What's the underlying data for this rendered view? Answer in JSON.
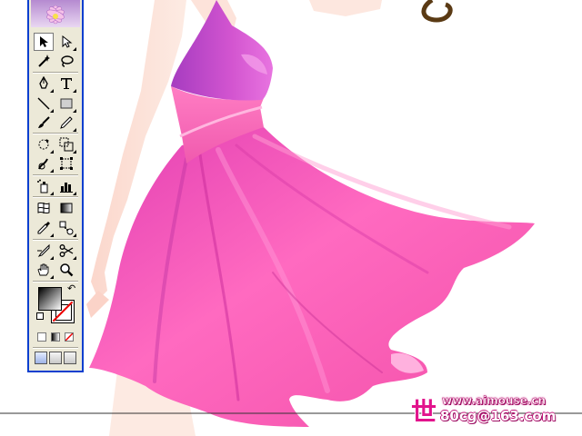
{
  "canvas": {
    "artwork": "fashion-illustration-pink-dress",
    "colors": {
      "dress_main": "#f04fb4",
      "dress_light": "#ff8fd0",
      "dress_shadow": "#b42fa8",
      "skin": "#fde6dc",
      "bodice": "#c644c8"
    }
  },
  "toolbox": {
    "tools": [
      {
        "name": "selection-tool",
        "icon": "arrow-icon",
        "selected": true
      },
      {
        "name": "direct-selection-tool",
        "icon": "hollow-arrow-icon",
        "selected": false
      },
      {
        "name": "magic-wand-tool",
        "icon": "magic-wand-icon",
        "selected": false
      },
      {
        "name": "lasso-tool",
        "icon": "lasso-icon",
        "selected": false
      },
      {
        "name": "pen-tool",
        "icon": "pen-icon",
        "selected": false
      },
      {
        "name": "type-tool",
        "icon": "type-icon",
        "selected": false
      },
      {
        "name": "line-segment-tool",
        "icon": "line-icon",
        "selected": false
      },
      {
        "name": "rectangle-tool",
        "icon": "rectangle-icon",
        "selected": false
      },
      {
        "name": "paintbrush-tool",
        "icon": "brush-icon",
        "selected": false
      },
      {
        "name": "pencil-tool",
        "icon": "pencil-icon",
        "selected": false
      },
      {
        "name": "rotate-tool",
        "icon": "rotate-icon",
        "selected": false
      },
      {
        "name": "scale-tool",
        "icon": "scale-icon",
        "selected": false
      },
      {
        "name": "warp-tool",
        "icon": "warp-icon",
        "selected": false
      },
      {
        "name": "free-transform-tool",
        "icon": "free-transform-icon",
        "selected": false
      },
      {
        "name": "symbol-sprayer-tool",
        "icon": "symbol-sprayer-icon",
        "selected": false
      },
      {
        "name": "column-graph-tool",
        "icon": "graph-icon",
        "selected": false
      },
      {
        "name": "mesh-tool",
        "icon": "mesh-icon",
        "selected": false
      },
      {
        "name": "gradient-tool",
        "icon": "gradient-icon",
        "selected": false
      },
      {
        "name": "eyedropper-tool",
        "icon": "eyedropper-icon",
        "selected": false
      },
      {
        "name": "blend-tool",
        "icon": "blend-icon",
        "selected": false
      },
      {
        "name": "slice-tool",
        "icon": "slice-icon",
        "selected": false
      },
      {
        "name": "scissors-tool",
        "icon": "scissors-icon",
        "selected": false
      },
      {
        "name": "hand-tool",
        "icon": "hand-icon",
        "selected": false
      },
      {
        "name": "zoom-tool",
        "icon": "zoom-icon",
        "selected": false
      }
    ],
    "fill_color": "gradient-black-white",
    "stroke_color": "none"
  },
  "watermark": {
    "glyph": "世",
    "url": "www.aimouse.cn",
    "email": "80cg@163.com"
  }
}
